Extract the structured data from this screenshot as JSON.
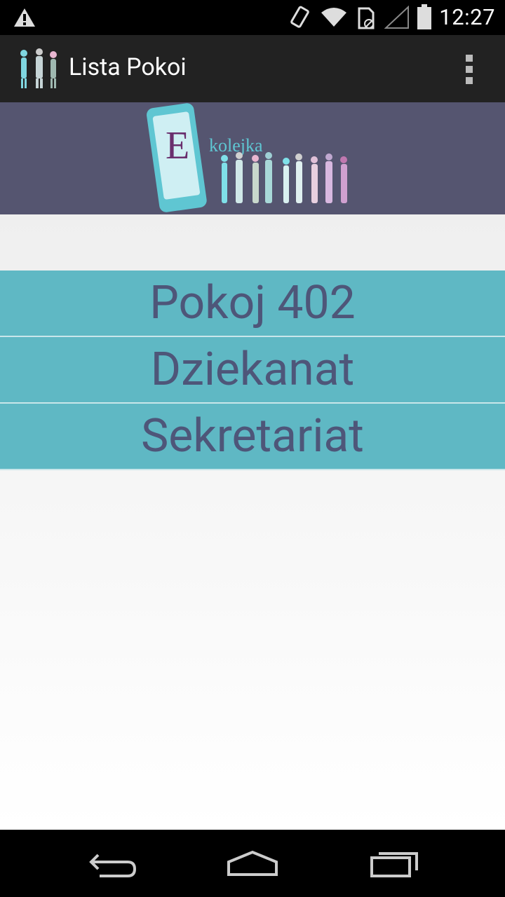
{
  "status_bar": {
    "time": "12:27",
    "icons": [
      "warning-icon",
      "vibrate-icon",
      "wifi-icon",
      "sim-icon",
      "signal-icon",
      "battery-icon"
    ]
  },
  "action_bar": {
    "title": "Lista Pokoi",
    "app_icon": "people-queue-icon",
    "overflow_icon": "overflow-menu-icon"
  },
  "banner": {
    "logo_letter": "E",
    "logo_text": "kolejka"
  },
  "rooms": [
    {
      "label": "Pokoj 402"
    },
    {
      "label": "Dziekanat"
    },
    {
      "label": "Sekretariat"
    }
  ],
  "nav_bar": {
    "buttons": [
      "back-icon",
      "home-icon",
      "recent-apps-icon"
    ]
  },
  "colors": {
    "list_item_bg": "#5fb8c4",
    "list_item_text": "#4e5679",
    "banner_bg": "#555570",
    "action_bar_bg": "#222222"
  }
}
